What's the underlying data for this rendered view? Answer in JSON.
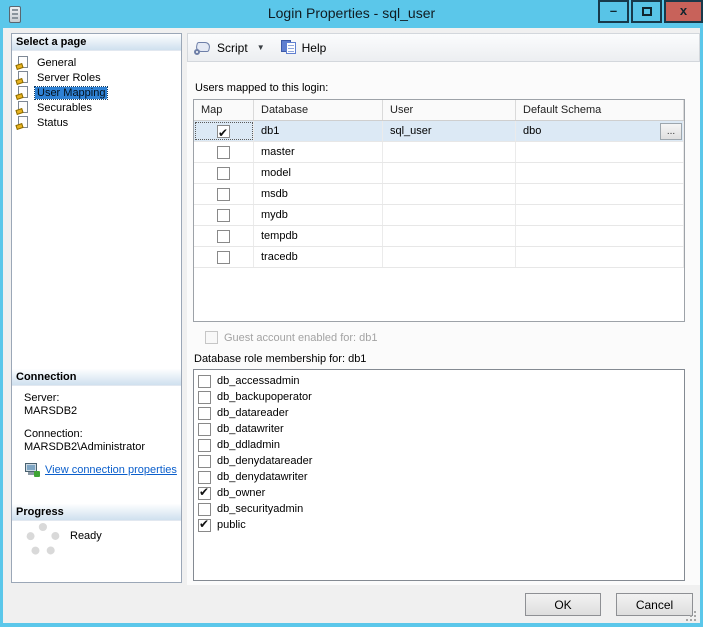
{
  "window": {
    "title": "Login Properties - sql_user",
    "minimize_glyph": "–",
    "close_glyph": "x"
  },
  "sidebar": {
    "select_a_page": {
      "header": "Select a page",
      "items": [
        {
          "label": "General",
          "selected": false
        },
        {
          "label": "Server Roles",
          "selected": false
        },
        {
          "label": "User Mapping",
          "selected": true
        },
        {
          "label": "Securables",
          "selected": false
        },
        {
          "label": "Status",
          "selected": false
        }
      ]
    },
    "connection": {
      "header": "Connection",
      "server_label": "Server:",
      "server_value": "MARSDB2",
      "connection_label": "Connection:",
      "connection_value": "MARSDB2\\Administrator",
      "link_label": "View connection properties"
    },
    "progress": {
      "header": "Progress",
      "status": "Ready"
    }
  },
  "toolbar": {
    "script_label": "Script",
    "dropdown_glyph": "▼",
    "help_label": "Help"
  },
  "main": {
    "users_mapped_label": "Users mapped to this login:",
    "table": {
      "columns": [
        "Map",
        "Database",
        "User",
        "Default Schema"
      ],
      "ellipsis_label": "...",
      "rows": [
        {
          "map": true,
          "database": "db1",
          "user": "sql_user",
          "default_schema": "dbo",
          "selected": true,
          "ellipsis": true
        },
        {
          "map": false,
          "database": "master",
          "user": "",
          "default_schema": ""
        },
        {
          "map": false,
          "database": "model",
          "user": "",
          "default_schema": ""
        },
        {
          "map": false,
          "database": "msdb",
          "user": "",
          "default_schema": ""
        },
        {
          "map": false,
          "database": "mydb",
          "user": "",
          "default_schema": ""
        },
        {
          "map": false,
          "database": "tempdb",
          "user": "",
          "default_schema": ""
        },
        {
          "map": false,
          "database": "tracedb",
          "user": "",
          "default_schema": ""
        }
      ]
    },
    "guest_checkbox_label": "Guest account enabled for: db1",
    "role_membership_label": "Database role membership for: db1",
    "roles": [
      {
        "label": "db_accessadmin",
        "checked": false
      },
      {
        "label": "db_backupoperator",
        "checked": false
      },
      {
        "label": "db_datareader",
        "checked": false
      },
      {
        "label": "db_datawriter",
        "checked": false
      },
      {
        "label": "db_ddladmin",
        "checked": false
      },
      {
        "label": "db_denydatareader",
        "checked": false
      },
      {
        "label": "db_denydatawriter",
        "checked": false
      },
      {
        "label": "db_owner",
        "checked": true
      },
      {
        "label": "db_securityadmin",
        "checked": false
      },
      {
        "label": "public",
        "checked": true
      }
    ]
  },
  "footer": {
    "ok_label": "OK",
    "cancel_label": "Cancel"
  },
  "colors": {
    "titlebar_blue": "#5BC7EA",
    "close_red": "#C8625A",
    "selection_blue": "#2E81D4",
    "row_highlight": "#DCE9F5",
    "link_blue": "#0B5FCC"
  }
}
